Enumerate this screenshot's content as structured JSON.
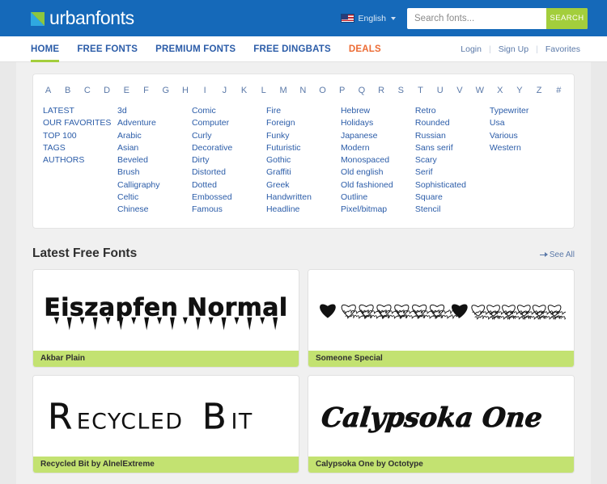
{
  "header": {
    "logo_text": "urbanfonts",
    "logo_icon": "urbanfonts-logo-mark",
    "language_label": "English",
    "flag_icon": "us-flag-icon",
    "search": {
      "placeholder": "Search fonts...",
      "value": "",
      "button_label": "SEARCH"
    }
  },
  "nav": {
    "items": [
      {
        "label": "HOME",
        "active": true,
        "style": "primary"
      },
      {
        "label": "FREE FONTS",
        "active": false,
        "style": "primary"
      },
      {
        "label": "PREMIUM FONTS",
        "active": false,
        "style": "primary"
      },
      {
        "label": "FREE DINGBATS",
        "active": false,
        "style": "primary"
      },
      {
        "label": "DEALS",
        "active": false,
        "style": "deals"
      }
    ],
    "account": [
      {
        "label": "Login"
      },
      {
        "label": "Sign Up"
      },
      {
        "label": "Favorites"
      }
    ]
  },
  "alphabet": [
    "A",
    "B",
    "C",
    "D",
    "E",
    "F",
    "G",
    "H",
    "I",
    "J",
    "K",
    "L",
    "M",
    "N",
    "O",
    "P",
    "Q",
    "R",
    "S",
    "T",
    "U",
    "V",
    "W",
    "X",
    "Y",
    "Z",
    "#"
  ],
  "categories": [
    {
      "items": [
        "LATEST",
        "OUR FAVORITES",
        "TOP 100",
        "TAGS",
        "AUTHORS"
      ]
    },
    {
      "items": [
        "3d",
        "Adventure",
        "Arabic",
        "Asian",
        "Beveled",
        "Brush",
        "Calligraphy",
        "Celtic",
        "Chinese"
      ]
    },
    {
      "items": [
        "Comic",
        "Computer",
        "Curly",
        "Decorative",
        "Dirty",
        "Distorted",
        "Dotted",
        "Embossed",
        "Famous"
      ]
    },
    {
      "items": [
        "Fire",
        "Foreign",
        "Funky",
        "Futuristic",
        "Gothic",
        "Graffiti",
        "Greek",
        "Handwritten",
        "Headline"
      ]
    },
    {
      "items": [
        "Hebrew",
        "Holidays",
        "Japanese",
        "Modern",
        "Monospaced",
        "Old english",
        "Old fashioned",
        "Outline",
        "Pixel/bitmap"
      ]
    },
    {
      "items": [
        "Retro",
        "Rounded",
        "Russian",
        "Sans serif",
        "Scary",
        "Serif",
        "Sophisticated",
        "Square",
        "Stencil"
      ]
    },
    {
      "items": [
        "Typewriter",
        "Usa",
        "Various",
        "Western"
      ]
    }
  ],
  "section": {
    "title": "Latest Free Fonts",
    "see_all_label": "See All"
  },
  "font_cards": [
    {
      "preview_text": "Eiszapfen Normal",
      "preview_style": "icicle-display",
      "label": "Akbar Plain"
    },
    {
      "preview_text": "",
      "preview_style": "dingbat-hearts",
      "label": "Someone Special"
    },
    {
      "preview_text": "Recycled Bit",
      "preview_style": "thin-smallcaps",
      "label": "Recycled Bit by AlnelExtreme"
    },
    {
      "preview_text": "Calypsoka One",
      "preview_style": "brush-script",
      "label": "Calypsoka One by Octotype"
    }
  ],
  "colors": {
    "header_blue": "#1569b9",
    "accent_green": "#a3ce3c",
    "label_green": "#c3e271",
    "link_blue": "#2b5ca8",
    "deals_orange": "#ec6b34",
    "page_gray": "#e9e9e9"
  }
}
